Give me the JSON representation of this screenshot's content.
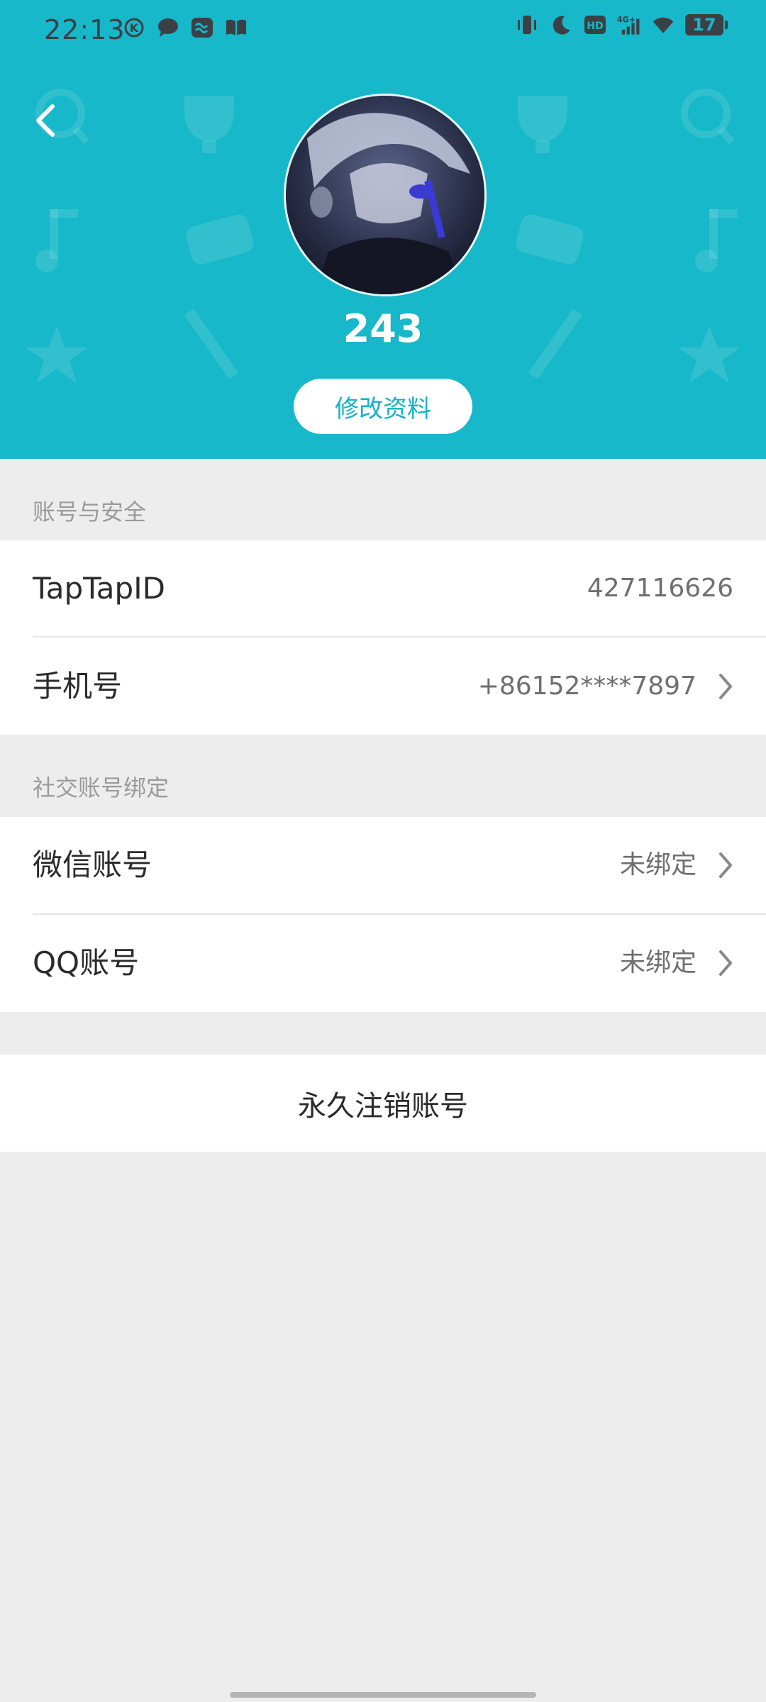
{
  "status_bar": {
    "time": "22:13",
    "battery": "17",
    "left_icons": [
      "k-icon",
      "chat-bubble-icon",
      "message-app-icon",
      "book-icon"
    ],
    "right_icons": [
      "vibrate-icon",
      "moon-icon",
      "hd-icon",
      "4g-signal-icon",
      "wifi-icon",
      "battery-icon"
    ]
  },
  "header": {
    "background_color": "#16b8c9",
    "username": "243",
    "edit_profile_label": "修改资料"
  },
  "sections": {
    "account_security": {
      "title": "账号与安全",
      "taptap_id_label": "TapTapID",
      "taptap_id_value": "427116626",
      "phone_label": "手机号",
      "phone_value": "+86152****7897"
    },
    "social_binding": {
      "title": "社交账号绑定",
      "wechat_label": "微信账号",
      "wechat_value": "未绑定",
      "qq_label": "QQ账号",
      "qq_value": "未绑定"
    }
  },
  "delete_account_label": "永久注销账号"
}
